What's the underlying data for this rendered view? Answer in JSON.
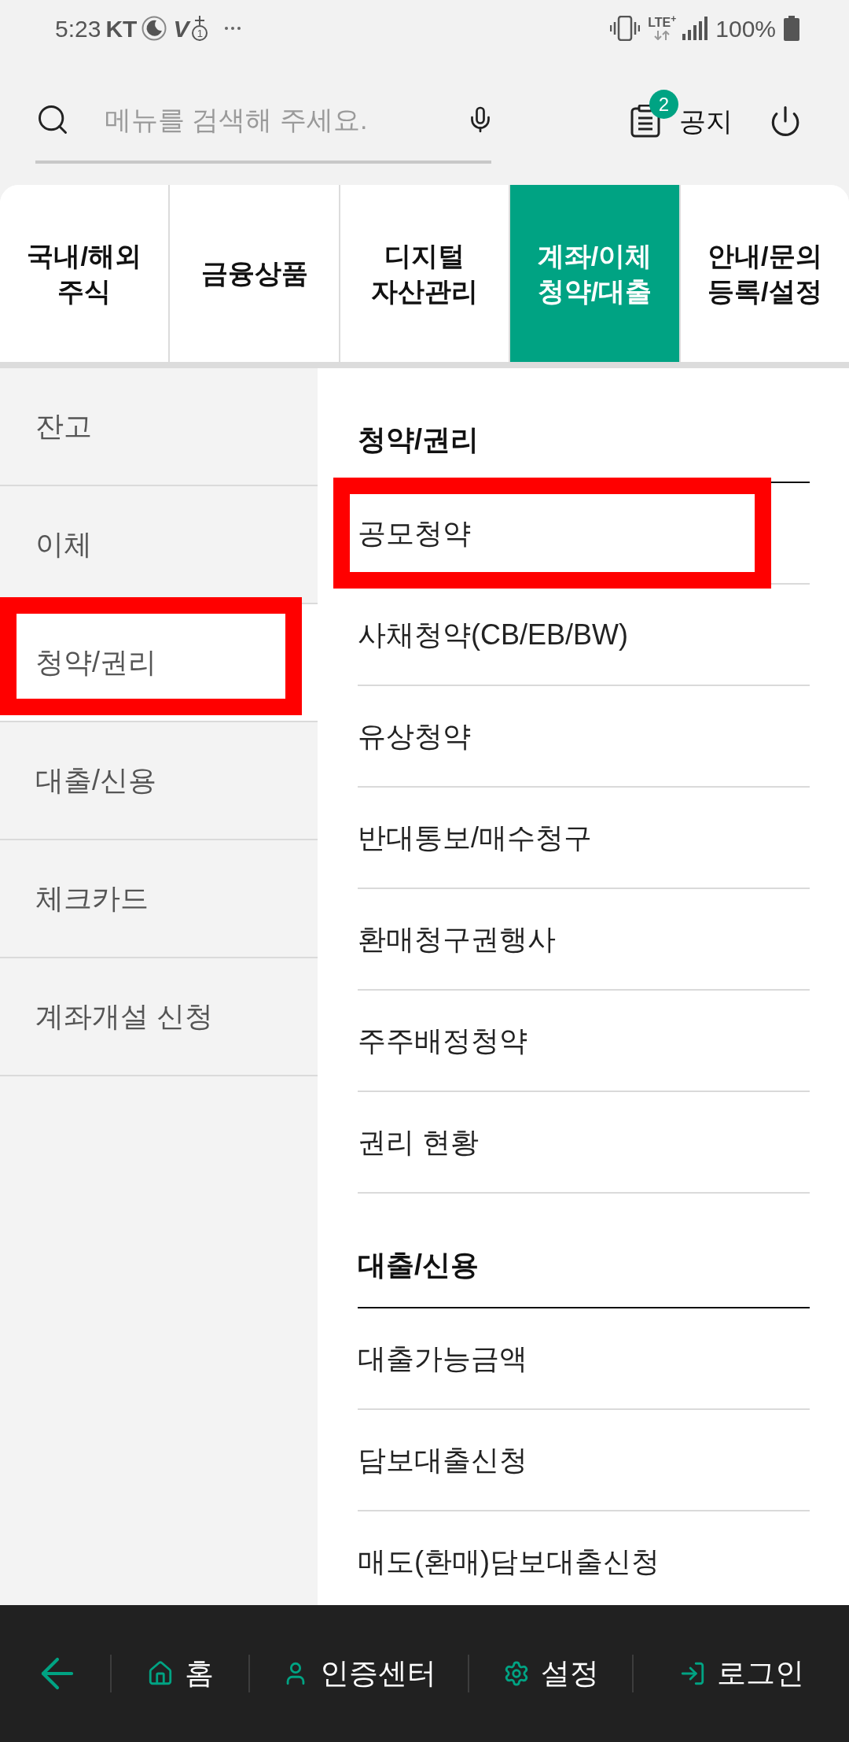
{
  "status_bar": {
    "time": "5:23",
    "carrier": "KT",
    "voice_label": "V",
    "sim_slot": "1",
    "network": "LTE$^{+}$",
    "battery": "100%"
  },
  "search": {
    "placeholder": "메뉴를 검색해 주세요."
  },
  "notice": {
    "label": "공지",
    "count": "2"
  },
  "tabs": [
    {
      "label": "국내/해외\n주식",
      "selected": false
    },
    {
      "label": "금융상품",
      "selected": false
    },
    {
      "label": "디지털\n자산관리",
      "selected": false
    },
    {
      "label": "계좌/이체\n청약/대출",
      "selected": true
    },
    {
      "label": "안내/문의\n등록/설정",
      "selected": false
    }
  ],
  "sidebar": {
    "items": [
      {
        "label": "잔고",
        "selected": false,
        "highlighted": false
      },
      {
        "label": "이체",
        "selected": false,
        "highlighted": false
      },
      {
        "label": "청약/권리",
        "selected": true,
        "highlighted": true
      },
      {
        "label": "대출/신용",
        "selected": false,
        "highlighted": false
      },
      {
        "label": "체크카드",
        "selected": false,
        "highlighted": false
      },
      {
        "label": "계좌개설 신청",
        "selected": false,
        "highlighted": false
      }
    ]
  },
  "submenu": {
    "sections": [
      {
        "title": "청약/권리",
        "items": [
          {
            "label": "공모청약",
            "highlighted": true
          },
          {
            "label": "사채청약(CB/EB/BW)",
            "highlighted": false
          },
          {
            "label": "유상청약",
            "highlighted": false
          },
          {
            "label": "반대통보/매수청구",
            "highlighted": false
          },
          {
            "label": "환매청구권행사",
            "highlighted": false
          },
          {
            "label": "주주배정청약",
            "highlighted": false
          },
          {
            "label": "권리 현황",
            "highlighted": false
          }
        ]
      },
      {
        "title": "대출/신용",
        "items": [
          {
            "label": "대출가능금액",
            "highlighted": false
          },
          {
            "label": "담보대출신청",
            "highlighted": false
          },
          {
            "label": "매도(환매)담보대출신청",
            "highlighted": false
          }
        ]
      }
    ]
  },
  "bottom_bar": {
    "items": [
      {
        "kind": "home",
        "label": "홈"
      },
      {
        "kind": "user",
        "label": "인증센터"
      },
      {
        "kind": "gear",
        "label": "설정"
      },
      {
        "kind": "login",
        "label": "로그인"
      }
    ]
  }
}
